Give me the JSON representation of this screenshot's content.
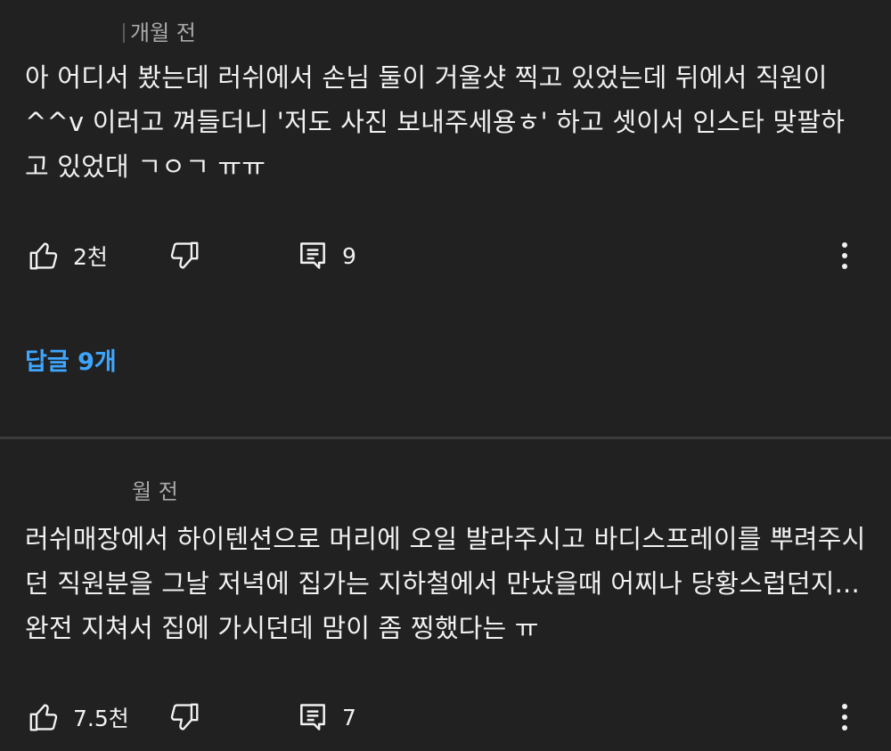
{
  "comments": [
    {
      "time": "개월 전",
      "text": "아 어디서 봤는데 러쉬에서 손님 둘이 거울샷 찍고 있었는데 뒤에서 직원이 ^^v 이러고 껴들더니 '저도 사진 보내주세용ㅎ' 하고 셋이서 인스타 맞팔하고 있었대 ㄱㅇㄱ ㅠㅠ",
      "likes": "2천",
      "reply_count": "9",
      "replies_link": "답글 9개"
    },
    {
      "time": "월 전",
      "text": "러쉬매장에서 하이텐션으로 머리에 오일 발라주시고 바디스프레이를 뿌려주시던 직원분을 그날 저녁에 집가는 지하철에서 만났을때 어찌나 당황스럽던지... 완전 지쳐서 집에 가시던데 맘이 좀 찡했다는 ㅠ",
      "likes": "7.5천",
      "reply_count": "7"
    }
  ],
  "icons": {
    "like": "thumbs-up-icon",
    "dislike": "thumbs-down-icon",
    "reply": "comment-icon",
    "more": "more-vertical-icon"
  },
  "colors": {
    "background": "#212121",
    "text": "#f1f1f1",
    "meta": "#aaaaaa",
    "link": "#3ea6ff",
    "divider": "#3b3b3b"
  }
}
